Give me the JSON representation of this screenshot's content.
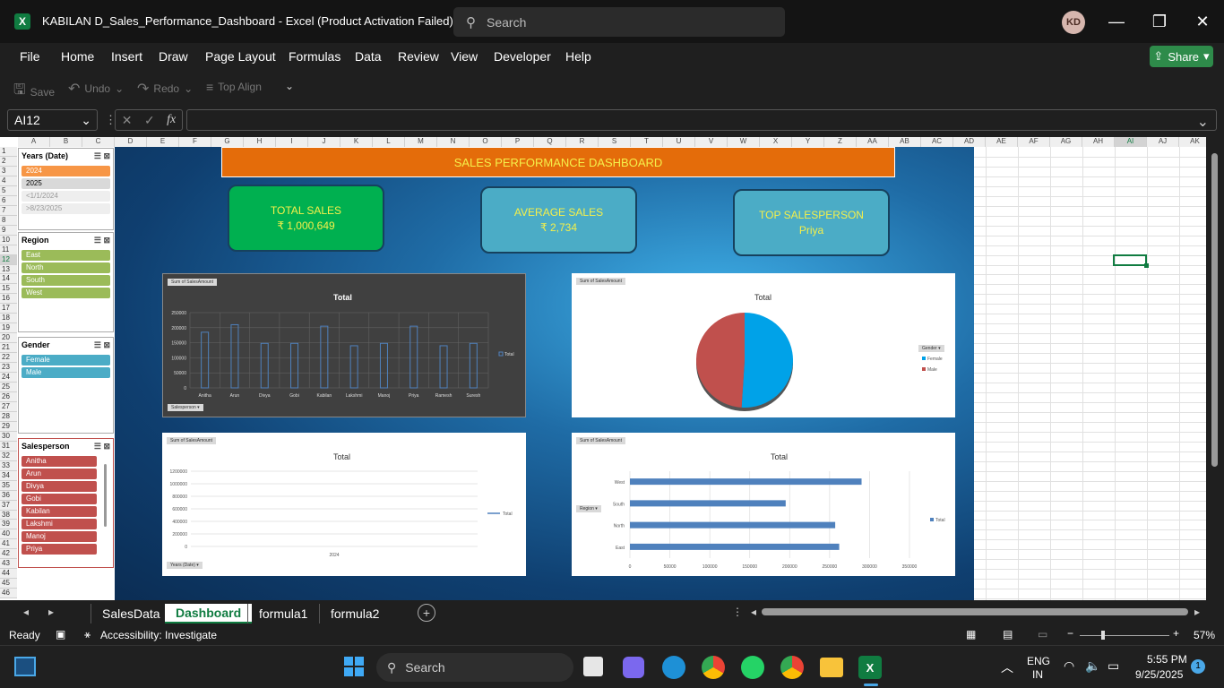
{
  "window": {
    "title": "KABILAN D_Sales_Performance_Dashboard  -  Excel (Product Activation Failed)",
    "search_placeholder": "Search",
    "user_initials": "KD"
  },
  "menu": [
    "File",
    "Home",
    "Insert",
    "Draw",
    "Page Layout",
    "Formulas",
    "Data",
    "Review",
    "View",
    "Developer",
    "Help"
  ],
  "share_label": "Share",
  "qat": {
    "save": "Save",
    "undo": "Undo",
    "redo": "Redo",
    "align": "Top Align"
  },
  "formula": {
    "name_box": "AI12",
    "fx": "fx",
    "content": ""
  },
  "columns": [
    "A",
    "B",
    "C",
    "D",
    "E",
    "F",
    "G",
    "H",
    "I",
    "J",
    "K",
    "L",
    "M",
    "N",
    "O",
    "P",
    "Q",
    "R",
    "S",
    "T",
    "U",
    "V",
    "W",
    "X",
    "Y",
    "Z",
    "AA",
    "AB",
    "AC",
    "AD",
    "AE",
    "AF",
    "AG",
    "AH",
    "AI",
    "AJ",
    "AK"
  ],
  "rows": [
    "1",
    "2",
    "3",
    "4",
    "5",
    "6",
    "7",
    "8",
    "9",
    "10",
    "11",
    "12",
    "13",
    "14",
    "15",
    "16",
    "17",
    "18",
    "19",
    "20",
    "21",
    "22",
    "23",
    "24",
    "25",
    "26",
    "27",
    "28",
    "29",
    "30",
    "31",
    "32",
    "33",
    "34",
    "35",
    "36",
    "37",
    "38",
    "39",
    "40",
    "41",
    "42",
    "43",
    "44",
    "45",
    "46"
  ],
  "slicers": {
    "years": {
      "title": "Years (Date)",
      "items": [
        "2024",
        "2025",
        "<1/1/2024",
        ">8/23/2025"
      ]
    },
    "region": {
      "title": "Region",
      "items": [
        "East",
        "North",
        "South",
        "West"
      ]
    },
    "gender": {
      "title": "Gender",
      "items": [
        "Female",
        "Male"
      ]
    },
    "salesperson": {
      "title": "Salesperson",
      "items": [
        "Anitha",
        "Arun",
        "Divya",
        "Gobi",
        "Kabilan",
        "Lakshmi",
        "Manoj",
        "Priya"
      ]
    }
  },
  "dashboard": {
    "banner": "SALES PERFORMANCE  DASHBOARD",
    "cards": [
      {
        "label": "TOTAL SALES",
        "value": "₹ 1,000,649"
      },
      {
        "label": "AVERAGE SALES",
        "value": "₹ 2,734"
      },
      {
        "label": "TOP SALESPERSON",
        "value": "Priya"
      }
    ]
  },
  "chart_data": [
    {
      "type": "bar",
      "title": "Total",
      "field_button": "Sum of SalesAmount",
      "axis_button": "Salesperson",
      "legend": "Total",
      "categories": [
        "Anitha",
        "Arun",
        "Divya",
        "Gobi",
        "Kabilan",
        "Lakshmi",
        "Manoj",
        "Priya",
        "Ramesh",
        "Suresh"
      ],
      "values": [
        185000,
        210000,
        148000,
        148000,
        205000,
        140000,
        148000,
        205000,
        140000,
        148000
      ],
      "yticks": [
        "250000",
        "200000",
        "150000",
        "100000",
        "50000",
        "0"
      ],
      "ylim": [
        0,
        250000
      ]
    },
    {
      "type": "pie",
      "title": "Total",
      "field_button": "Sum of SalesAmount",
      "legend_button": "Gender",
      "categories": [
        "Female",
        "Male"
      ],
      "values": [
        51,
        49
      ],
      "colors": [
        "#00a2e8",
        "#c0504d"
      ]
    },
    {
      "type": "line",
      "title": "Total",
      "field_button": "Sum of SalesAmount",
      "axis_button": "Years (Date)",
      "legend": "Total",
      "categories": [
        "2024"
      ],
      "yticks": [
        "1200000",
        "1000000",
        "800000",
        "600000",
        "400000",
        "200000",
        "0"
      ],
      "ylim": [
        0,
        1200000
      ]
    },
    {
      "type": "bar",
      "orientation": "horizontal",
      "title": "Total",
      "field_button": "Sum of SalesAmount",
      "axis_button": "Region",
      "legend": "Total",
      "categories": [
        "West",
        "South",
        "North",
        "East"
      ],
      "values": [
        290000,
        195000,
        257000,
        262000
      ],
      "xticks": [
        "0",
        "50000",
        "100000",
        "150000",
        "200000",
        "250000",
        "300000",
        "350000"
      ],
      "xlim": [
        0,
        350000
      ]
    }
  ],
  "sheet_tabs": [
    "SalesData",
    "Dashboard",
    "formula1",
    "formula2"
  ],
  "active_tab": "Dashboard",
  "status": {
    "ready": "Ready",
    "accessibility": "Accessibility: Investigate",
    "zoom": "57%"
  },
  "taskbar": {
    "search": "Search",
    "lang1": "ENG",
    "lang2": "IN",
    "time": "5:55 PM",
    "date": "9/25/2025",
    "badge": "1"
  }
}
